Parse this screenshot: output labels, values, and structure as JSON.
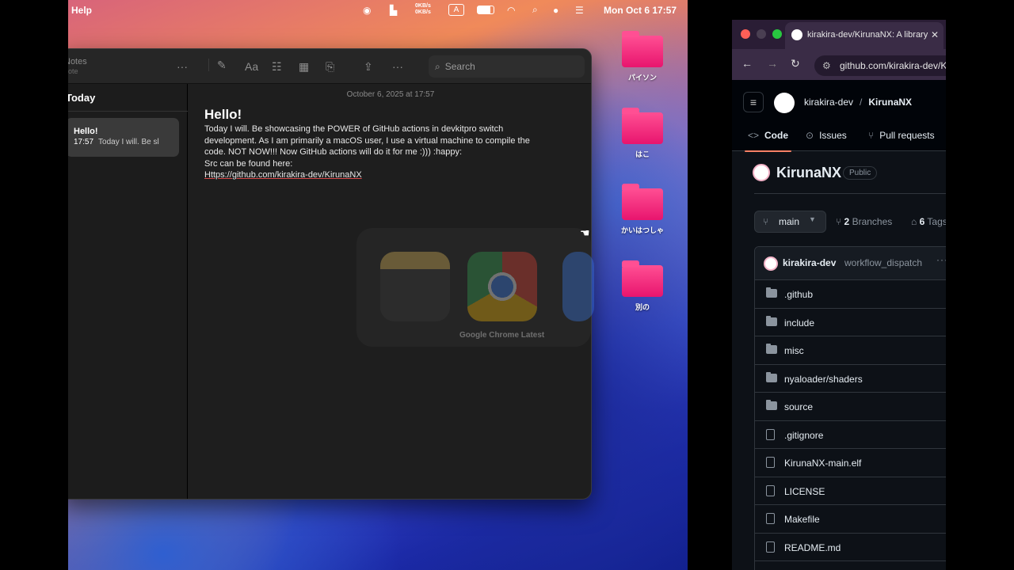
{
  "menubar": {
    "help": "Help",
    "net_up": "0KB/s",
    "net_down": "0KB/s",
    "input_mode": "A",
    "clock": "Mon Oct 6  17:57"
  },
  "desktop": {
    "folders": [
      "パイソン",
      "はこ",
      "かいはつしゃ",
      "別の"
    ]
  },
  "notes": {
    "app_title": "Notes",
    "app_subtitle": "note",
    "search_placeholder": "Search",
    "section": "Today",
    "note_item": {
      "title": "Hello!",
      "time": "17:57",
      "preview": "Today I will. Be sl"
    },
    "date": "October 6, 2025 at 17:57",
    "heading": "Hello!",
    "body_lines": [
      "Today I will. Be showcasing the POWER of GitHub actions in devkitpro switch",
      "development. As I am primarily a macOS user, I use a virtual machine to compile the",
      "code. NOT NOW!!! Now GitHub actions will do it for me :))) :happy:",
      "Src can be found here:"
    ],
    "link": "Https://github.com/kirakira-dev/KirunaNX"
  },
  "switcher": {
    "label": "Google Chrome Latest"
  },
  "browser": {
    "tab_title": "kirakira-dev/KirunaNX: A library",
    "url": "github.com/kirakira-dev/KirunaNX",
    "owner": "kirakira-dev",
    "repo": "KirunaNX",
    "tabs": [
      "Code",
      "Issues",
      "Pull requests"
    ],
    "repo_title": "KirunaNX",
    "visibility": "Public",
    "branch": "main",
    "branches_count": "2",
    "branches_label": "Branches",
    "tags_count": "6",
    "tags_label": "Tags",
    "commit_user": "kirakira-dev",
    "commit_msg": "workflow_dispatch",
    "files": [
      {
        "name": ".github",
        "type": "folder"
      },
      {
        "name": "include",
        "type": "folder"
      },
      {
        "name": "misc",
        "type": "folder"
      },
      {
        "name": "nyaloader/shaders",
        "type": "folder"
      },
      {
        "name": "source",
        "type": "folder"
      },
      {
        "name": ".gitignore",
        "type": "file"
      },
      {
        "name": "KirunaNX-main.elf",
        "type": "file"
      },
      {
        "name": "LICENSE",
        "type": "file"
      },
      {
        "name": "Makefile",
        "type": "file"
      },
      {
        "name": "README.md",
        "type": "file"
      }
    ]
  }
}
